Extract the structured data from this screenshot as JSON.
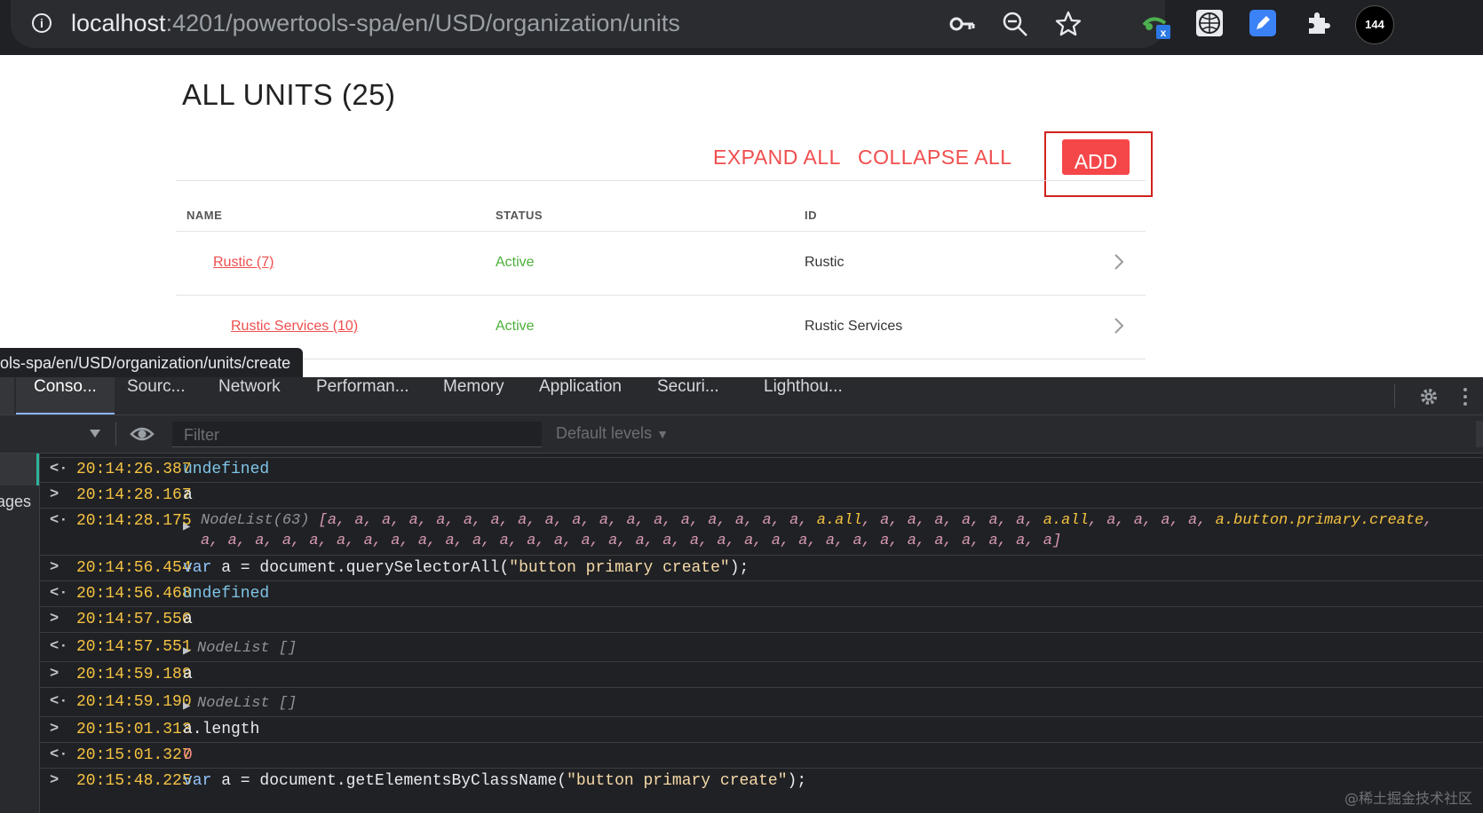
{
  "browser": {
    "url_host": "localhost",
    "url_path": ":4201/powertools-spa/en/USD/organization/units",
    "status_url": "ols-spa/en/USD/organization/units/create",
    "extension_badge": "144",
    "extension_x": "x",
    "icons": [
      "info-icon",
      "key-icon",
      "zoom-out-icon",
      "star-icon",
      "extension-icon",
      "globe-icon",
      "edit-icon",
      "puzzle-icon",
      "profile-avatar"
    ]
  },
  "page": {
    "title": "ALL UNITS (25)",
    "expand_all": "EXPAND ALL",
    "collapse_all": "COLLAPSE ALL",
    "add_label": "ADD",
    "columns": [
      "NAME",
      "STATUS",
      "ID"
    ],
    "rows": [
      {
        "name": "Rustic (7)",
        "status": "Active",
        "id": "Rustic"
      },
      {
        "name": "Rustic Services (10)",
        "status": "Active",
        "id": "Rustic Services"
      }
    ]
  },
  "devtools": {
    "tabs": [
      "Conso...",
      "Sourc...",
      "Network",
      "Performan...",
      "Memory",
      "Application",
      "Securi...",
      "Lighthou..."
    ],
    "filter_placeholder": "Filter",
    "levels_label": "Default levels",
    "side_label": "ages"
  },
  "console": {
    "t1": "20:14:26.387",
    "v1": "undefined",
    "t2": "20:14:28.167",
    "v2": "a",
    "t3": "20:14:28.175",
    "nodelist63_label": "NodeList(63)",
    "nodelist_items_a": "a, a, a, a, a, a, a, a, a, a, a, a, a, a, a, a, a, a, ",
    "cls_all": "a.all",
    "nodelist_items_b": "a, a, a, a, a, a, ",
    "nodelist_items_c": "a, a, a, a, ",
    "cls_create": "a.button.primary.create",
    "nodelist_line2": "a, a, a, a, a, a, a, a, a, a, a, a, a, a, a, a, a, a, a, a, a, a, a, a, a, a, a, a, a, a, a, a]",
    "t4": "20:14:56.454",
    "v4_kw": "var",
    "v4_code": " a = document.querySelectorAll(",
    "v4_str": "\"button primary create\"",
    "v4_end": ");",
    "t5": "20:14:56.468",
    "v5": "undefined",
    "t6": "20:14:57.550",
    "v6": "a",
    "t7": "20:14:57.551",
    "v7": "NodeList []",
    "t8": "20:14:59.189",
    "v8": "a",
    "t9": "20:14:59.190",
    "v9": "NodeList []",
    "t10": "20:15:01.313",
    "v10": "a.length",
    "t11": "20:15:01.327",
    "v11": "0",
    "t12": "20:15:48.225",
    "v12_kw": "var",
    "v12_code": " a = document.getElementsByClassName(",
    "v12_str": "\"button primary create\"",
    "v12_end": ");"
  },
  "watermark": "@稀土掘金技术社区",
  "colors": {
    "accent_red": "#f04e4e",
    "active_green": "#4caf3a",
    "timestamp": "#f5c342"
  }
}
